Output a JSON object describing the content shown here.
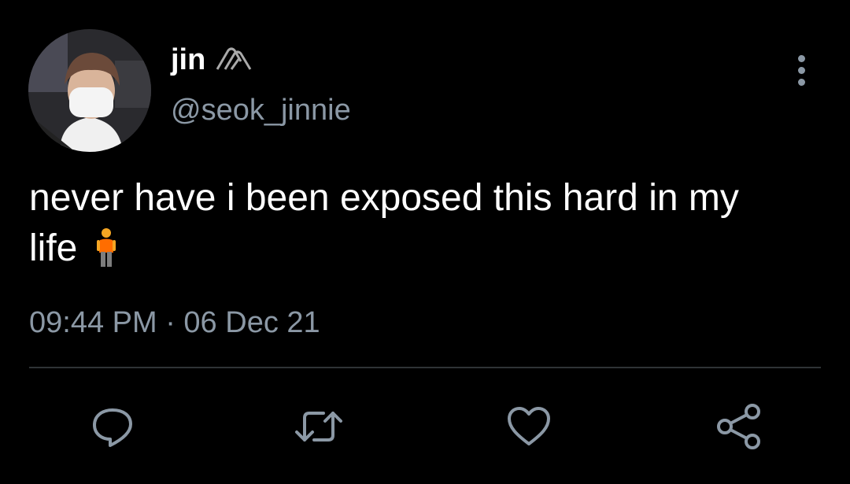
{
  "user": {
    "display_name": "jin",
    "handle": "@seok_jinnie",
    "avatar": "avatar"
  },
  "tweet": {
    "text_line1": "never have i been exposed this hard in my",
    "text_line2": "life",
    "emoji": "person-standing-emoji",
    "timestamp": "09:44 PM · 06 Dec 21"
  },
  "icons": {
    "name_badge": "carabiner-icon",
    "more": "more-vertical-icon",
    "reply": "reply-icon",
    "retweet": "retweet-icon",
    "like": "heart-icon",
    "share": "share-icon"
  },
  "colors": {
    "background": "#000000",
    "primary_text": "#ffffff",
    "secondary_text": "#8b98a5",
    "divider": "#2f3336"
  }
}
